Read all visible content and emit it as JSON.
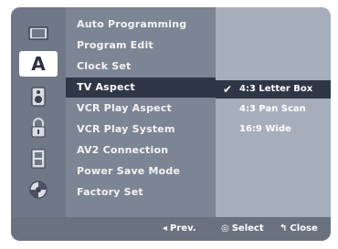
{
  "left_icons": [
    {
      "name": "disc-icon",
      "glyph": "disc"
    },
    {
      "name": "language-a-icon",
      "glyph": "A"
    },
    {
      "name": "speaker-icon",
      "glyph": "speaker"
    },
    {
      "name": "lock-icon",
      "glyph": "lock"
    },
    {
      "name": "film-icon",
      "glyph": "film"
    },
    {
      "name": "settings-disc-icon",
      "glyph": "disc2"
    }
  ],
  "menu": {
    "items": [
      {
        "label": "Auto Programming"
      },
      {
        "label": "Program Edit"
      },
      {
        "label": "Clock Set"
      },
      {
        "label": "TV Aspect"
      },
      {
        "label": "VCR Play Aspect"
      },
      {
        "label": "VCR Play System"
      },
      {
        "label": "AV2 Connection"
      },
      {
        "label": "Power Save Mode"
      },
      {
        "label": "Factory Set"
      }
    ],
    "selected_index": 3
  },
  "submenu": {
    "options": [
      {
        "label": "4:3 Letter Box",
        "checked": true
      },
      {
        "label": "4:3 Pan Scan"
      },
      {
        "label": "16:9 Wide"
      }
    ]
  },
  "footer": {
    "prev_glyph": "◂",
    "prev_label": "Prev.",
    "select_glyph": "◎",
    "select_label": "Select",
    "close_glyph": "↰",
    "close_label": "Close"
  }
}
